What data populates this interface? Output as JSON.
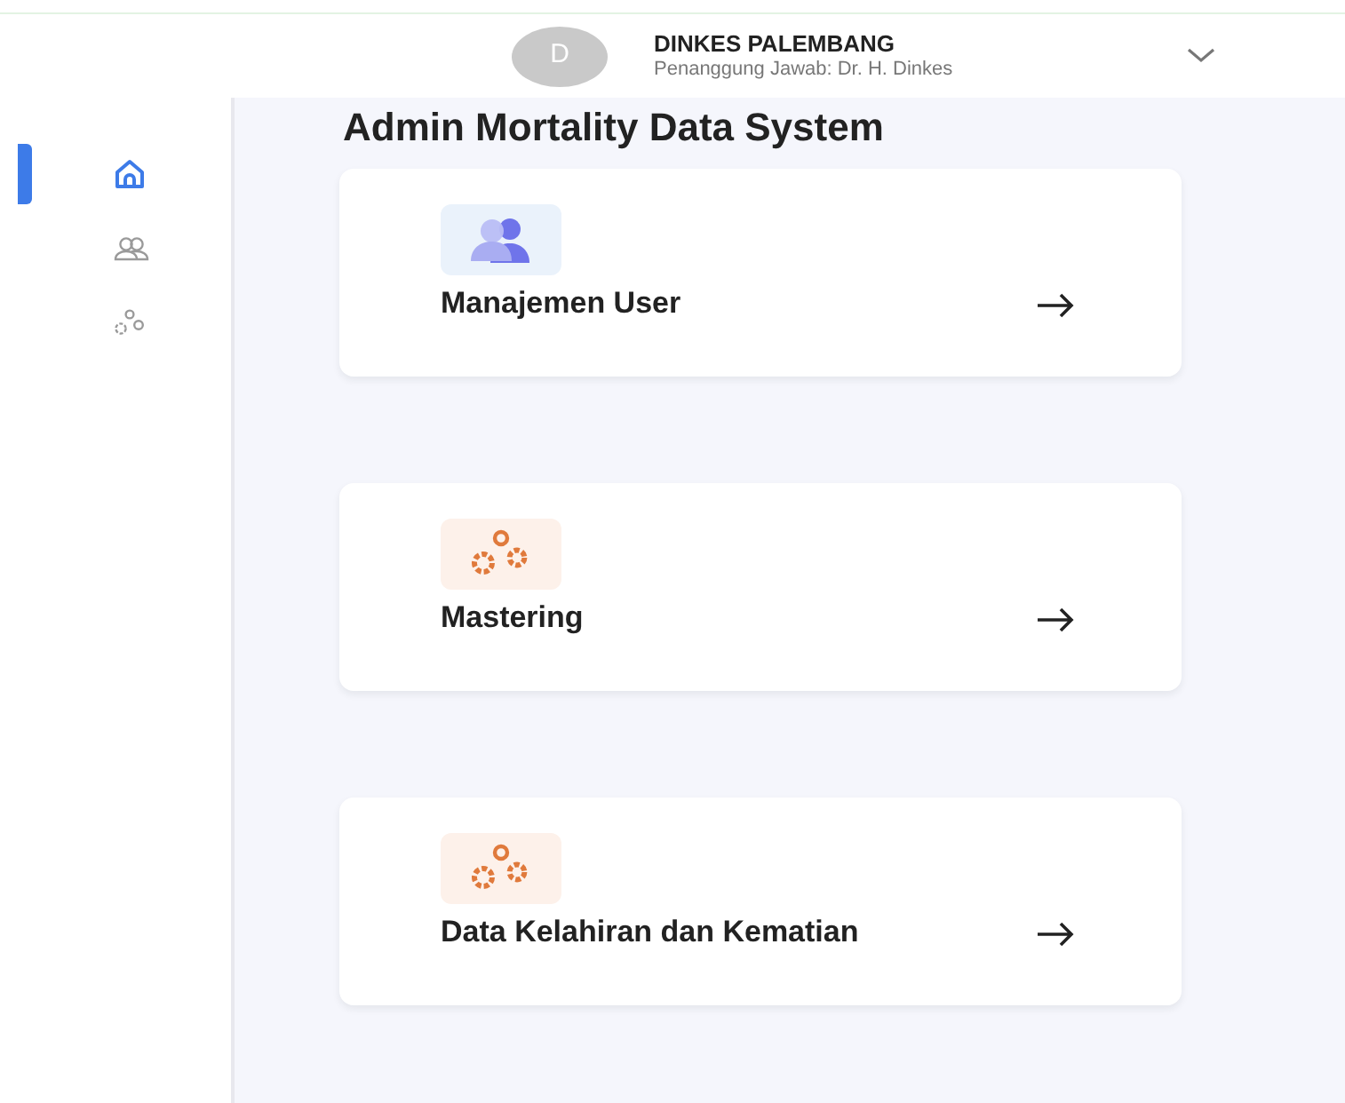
{
  "header": {
    "avatar_initial": "D",
    "user_name": "DINKES PALEMBANG",
    "user_role": "Penanggung Jawab: Dr. H. Dinkes"
  },
  "sidebar": {
    "items": [
      {
        "kind": "home",
        "selected": true
      },
      {
        "kind": "users",
        "selected": false
      },
      {
        "kind": "gears",
        "selected": false
      }
    ]
  },
  "page_title": "Admin Mortality Data System",
  "menu_cards": [
    {
      "kind": "users",
      "label": "Manajemen User"
    },
    {
      "kind": "gears",
      "label": "Mastering"
    },
    {
      "kind": "gears",
      "label": "Data Kelahiran dan Kematian"
    }
  ]
}
